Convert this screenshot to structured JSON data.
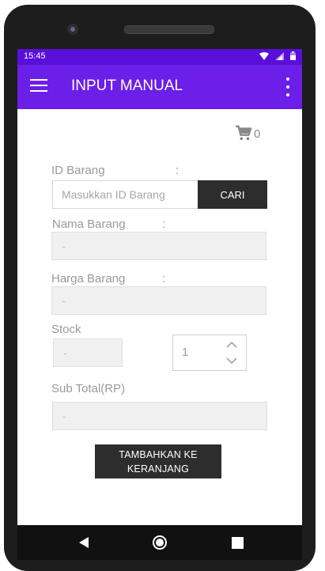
{
  "status_bar": {
    "time": "15:45",
    "icons": [
      "wifi-icon",
      "signal-icon",
      "battery-icon"
    ]
  },
  "app_bar": {
    "title": "INPUT MANUAL",
    "menu_icon": "menu-icon",
    "more_icon": "more-vert-icon",
    "background": "#6b1fe8"
  },
  "cart": {
    "icon": "cart-icon",
    "count": "0"
  },
  "form": {
    "id_barang": {
      "label": "ID Barang",
      "colon": ":",
      "placeholder": "Masukkan ID Barang",
      "value": ""
    },
    "cari_button": "CARI",
    "nama_barang": {
      "label": "Nama Barang",
      "colon": ":",
      "value": "-"
    },
    "harga_barang": {
      "label": "Harga Barang",
      "colon": ":",
      "value": "-"
    },
    "stock": {
      "label": "Stock",
      "value": "-"
    },
    "quantity": {
      "value": "1"
    },
    "sub_total": {
      "label": "Sub Total(RP)",
      "value": "-"
    },
    "add_button": {
      "line1": "TAMBAHKAN KE",
      "line2": "KERANJANG"
    }
  },
  "nav_bar": {
    "back": "back-icon",
    "home": "home-icon",
    "recents": "recents-icon"
  }
}
